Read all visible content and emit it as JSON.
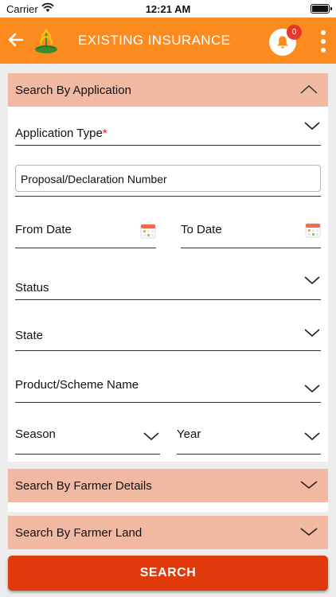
{
  "status_bar": {
    "carrier": "Carrier",
    "time": "12:21 AM"
  },
  "header": {
    "title": "EXISTING INSURANCE",
    "notification_count": "0",
    "accent_color": "#fb8b1e"
  },
  "search_by_application": {
    "label": "Search By Application",
    "expanded": true,
    "application_type": {
      "label": "Application Type",
      "required_mark": "*"
    },
    "proposal_number": {
      "placeholder": "Proposal/Declaration Number",
      "value": ""
    },
    "from_date": {
      "label": "From Date"
    },
    "to_date": {
      "label": "To Date"
    },
    "status": {
      "label": "Status"
    },
    "state": {
      "label": "State"
    },
    "product_scheme": {
      "label": "Product/Scheme Name"
    },
    "season": {
      "label": "Season"
    },
    "year": {
      "label": "Year"
    }
  },
  "search_by_farmer_details": {
    "label": "Search By Farmer Details",
    "expanded": false
  },
  "search_by_farmer_land": {
    "label": "Search By Farmer Land",
    "expanded": false
  },
  "search_button": {
    "label": "SEARCH",
    "color": "#e03a0c"
  },
  "icons": [
    "back-arrow-icon",
    "insurance-logo-icon",
    "bell-icon",
    "more-vertical-icon",
    "chevron-up-icon",
    "chevron-down-icon",
    "calendar-icon",
    "wifi-icon",
    "battery-icon"
  ]
}
